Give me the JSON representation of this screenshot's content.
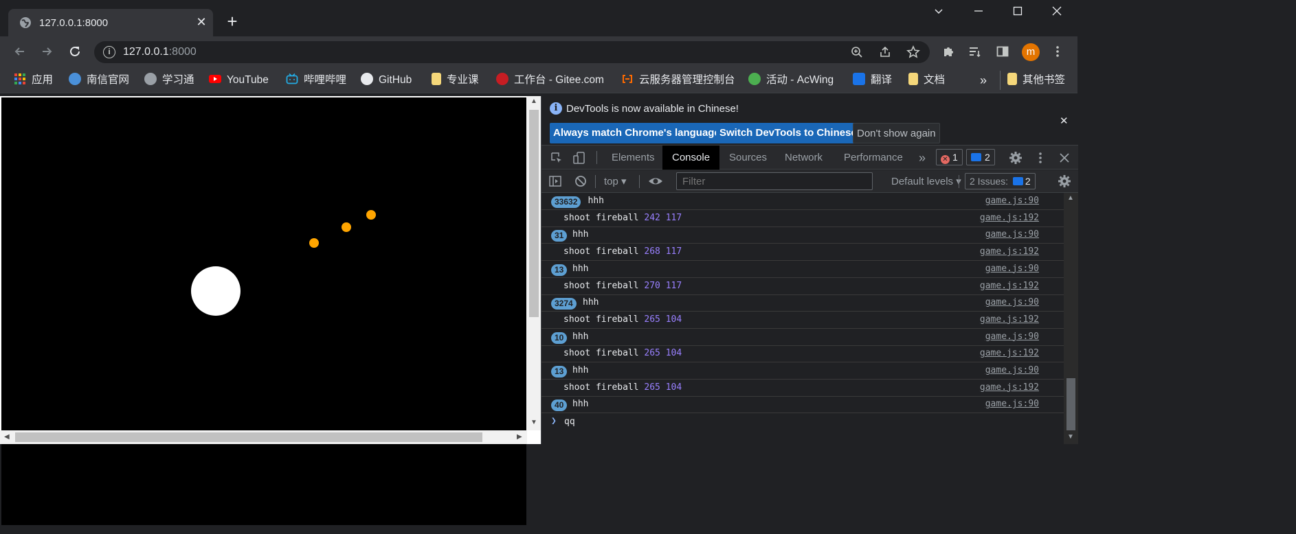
{
  "tab": {
    "title": "127.0.0.1:8000",
    "close": "✕",
    "new_tab": "+"
  },
  "window_controls": {
    "dropdown": "⌄",
    "minimize": "—",
    "maximize": "☐",
    "close": "✕"
  },
  "address": {
    "host": "127.0.0.1",
    "port": ":8000"
  },
  "avatar_letter": "m",
  "bookmarks": [
    {
      "label": "应用",
      "icon": "apps-grid-icon",
      "color": "#ea4335"
    },
    {
      "label": "南信官网",
      "icon": "university-icon",
      "color": "#4a90d9"
    },
    {
      "label": "学习通",
      "icon": "globe-icon",
      "color": "#9aa0a6"
    },
    {
      "label": "YouTube",
      "icon": "youtube-icon",
      "color": "#ff0000"
    },
    {
      "label": "哔哩哔哩",
      "icon": "bilibili-icon",
      "color": "#23ade5"
    },
    {
      "label": "GitHub",
      "icon": "github-icon",
      "color": "#e8eaed"
    },
    {
      "label": "专业课",
      "icon": "folder-icon",
      "color": "#f5d77a"
    },
    {
      "label": "工作台 - Gitee.com",
      "icon": "gitee-icon",
      "color": "#c71d23"
    },
    {
      "label": "云服务器管理控制台",
      "icon": "aliyun-icon",
      "color": "#ff6a00"
    },
    {
      "label": "活动 - AcWing",
      "icon": "acwing-icon",
      "color": "#4caf50"
    },
    {
      "label": "翻译",
      "icon": "translate-icon",
      "color": "#1a73e8"
    },
    {
      "label": "文档",
      "icon": "folder-icon",
      "color": "#f5d77a"
    }
  ],
  "bookmarks_more": "»",
  "other_bookmarks": "其他书签",
  "devtools": {
    "infobar_message": "DevTools is now available in Chinese!",
    "btn_match": "Always match Chrome's language",
    "btn_switch": "Switch DevTools to Chinese",
    "btn_dont_show": "Don't show again",
    "tabs": [
      "Elements",
      "Console",
      "Sources",
      "Network",
      "Performance"
    ],
    "active_tab": "Console",
    "more_tabs": "»",
    "error_count": "1",
    "message_count": "2",
    "context": "top",
    "filter_placeholder": "Filter",
    "levels": "Default levels",
    "issues_label": "2 Issues:",
    "issues_count": "2",
    "prompt_input": "qq"
  },
  "console_rows": [
    {
      "count": "33632",
      "text": "hhh",
      "nums": "",
      "source": "game.js:90"
    },
    {
      "count": "",
      "text": "shoot fireball",
      "nums": "242 117",
      "source": "game.js:192"
    },
    {
      "count": "31",
      "text": "hhh",
      "nums": "",
      "source": "game.js:90"
    },
    {
      "count": "",
      "text": "shoot fireball",
      "nums": "268 117",
      "source": "game.js:192"
    },
    {
      "count": "13",
      "text": "hhh",
      "nums": "",
      "source": "game.js:90"
    },
    {
      "count": "",
      "text": "shoot fireball",
      "nums": "270 117",
      "source": "game.js:192"
    },
    {
      "count": "3274",
      "text": "hhh",
      "nums": "",
      "source": "game.js:90"
    },
    {
      "count": "",
      "text": "shoot fireball",
      "nums": "265 104",
      "source": "game.js:192"
    },
    {
      "count": "10",
      "text": "hhh",
      "nums": "",
      "source": "game.js:90"
    },
    {
      "count": "",
      "text": "shoot fireball",
      "nums": "265 104",
      "source": "game.js:192"
    },
    {
      "count": "13",
      "text": "hhh",
      "nums": "",
      "source": "game.js:90"
    },
    {
      "count": "",
      "text": "shoot fireball",
      "nums": "265 104",
      "source": "game.js:192"
    },
    {
      "count": "40",
      "text": "hhh",
      "nums": "",
      "source": "game.js:90"
    }
  ],
  "colors": {
    "fireball": "#ffa500",
    "player": "#ffffff",
    "canvas_bg": "#000000",
    "count_badge": "#5d9fd2",
    "console_number": "#9980ff"
  }
}
